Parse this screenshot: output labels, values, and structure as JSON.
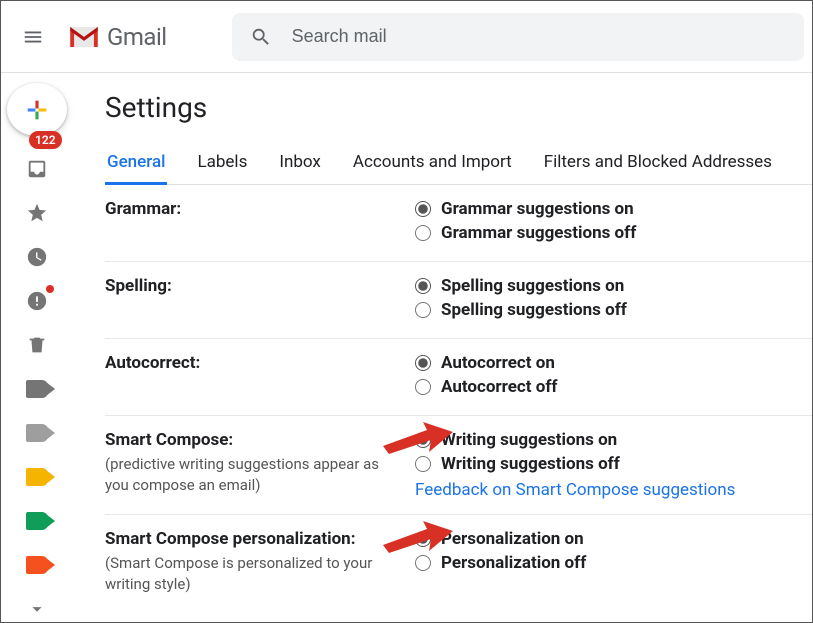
{
  "header": {
    "logo_text": "Gmail",
    "search_placeholder": "Search mail"
  },
  "sidebar": {
    "inbox_badge": "122"
  },
  "page_title": "Settings",
  "tabs": [
    "General",
    "Labels",
    "Inbox",
    "Accounts and Import",
    "Filters and Blocked Addresses"
  ],
  "active_tab": 0,
  "settings": {
    "grammar": {
      "label": "Grammar:",
      "on": "Grammar suggestions on",
      "off": "Grammar suggestions off"
    },
    "spelling": {
      "label": "Spelling:",
      "on": "Spelling suggestions on",
      "off": "Spelling suggestions off"
    },
    "autocorrect": {
      "label": "Autocorrect:",
      "on": "Autocorrect on",
      "off": "Autocorrect off"
    },
    "smart_compose": {
      "label": "Smart Compose:",
      "sub": "(predictive writing suggestions appear as you compose an email)",
      "on": "Writing suggestions on",
      "off": "Writing suggestions off",
      "feedback": "Feedback on Smart Compose suggestions"
    },
    "smart_personalization": {
      "label": "Smart Compose personalization:",
      "sub": "(Smart Compose is personalized to your writing style)",
      "on": "Personalization on",
      "off": "Personalization off"
    }
  },
  "tag_colors": [
    "#757575",
    "#9e9e9e",
    "#f4b400",
    "#0f9d58",
    "#f4511e"
  ]
}
